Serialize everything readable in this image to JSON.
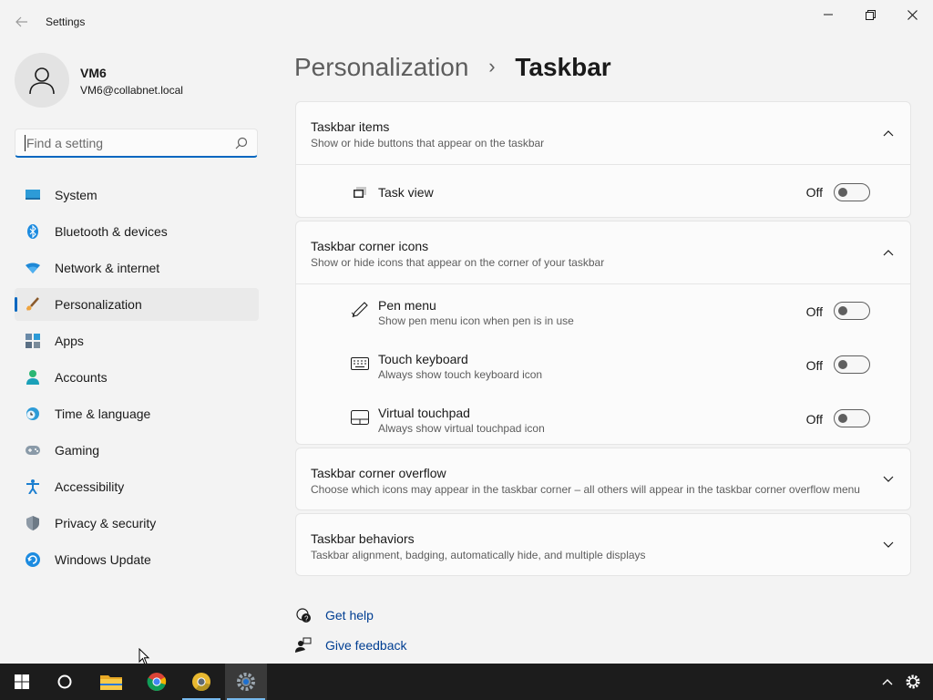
{
  "window": {
    "title": "Settings"
  },
  "profile": {
    "name": "VM6",
    "email": "VM6@collabnet.local"
  },
  "search": {
    "placeholder": "Find a setting"
  },
  "nav": [
    {
      "label": "System",
      "icon": "monitor-icon"
    },
    {
      "label": "Bluetooth & devices",
      "icon": "bluetooth-icon"
    },
    {
      "label": "Network & internet",
      "icon": "wifi-icon"
    },
    {
      "label": "Personalization",
      "icon": "brush-icon",
      "active": true
    },
    {
      "label": "Apps",
      "icon": "apps-icon"
    },
    {
      "label": "Accounts",
      "icon": "person-icon"
    },
    {
      "label": "Time & language",
      "icon": "clock-globe-icon"
    },
    {
      "label": "Gaming",
      "icon": "gamepad-icon"
    },
    {
      "label": "Accessibility",
      "icon": "accessibility-icon"
    },
    {
      "label": "Privacy & security",
      "icon": "shield-icon"
    },
    {
      "label": "Windows Update",
      "icon": "update-icon"
    }
  ],
  "breadcrumb": {
    "parent": "Personalization",
    "separator": "›",
    "current": "Taskbar"
  },
  "sections": {
    "taskbar_items": {
      "title": "Taskbar items",
      "desc": "Show or hide buttons that appear on the taskbar",
      "expanded": true,
      "rows": [
        {
          "title": "Task view",
          "state": "Off",
          "on": false
        }
      ]
    },
    "corner_icons": {
      "title": "Taskbar corner icons",
      "desc": "Show or hide icons that appear on the corner of your taskbar",
      "expanded": true,
      "rows": [
        {
          "title": "Pen menu",
          "desc": "Show pen menu icon when pen is in use",
          "state": "Off",
          "on": false
        },
        {
          "title": "Touch keyboard",
          "desc": "Always show touch keyboard icon",
          "state": "Off",
          "on": false
        },
        {
          "title": "Virtual touchpad",
          "desc": "Always show virtual touchpad icon",
          "state": "Off",
          "on": false
        }
      ]
    },
    "corner_overflow": {
      "title": "Taskbar corner overflow",
      "desc": "Choose which icons may appear in the taskbar corner – all others will appear in the taskbar corner overflow menu",
      "expanded": false
    },
    "behaviors": {
      "title": "Taskbar behaviors",
      "desc": "Taskbar alignment, badging, automatically hide, and multiple displays",
      "expanded": false
    }
  },
  "links": {
    "help": "Get help",
    "feedback": "Give feedback"
  },
  "taskbar": {
    "apps": [
      "start-icon",
      "cortana-icon",
      "file-explorer-icon",
      "chrome-icon",
      "chrome-canary-icon",
      "settings-icon"
    ],
    "tray": [
      "chevron-up-icon",
      "gear-icon"
    ]
  },
  "colors": {
    "accent": "#0067c0",
    "link": "#003e92",
    "taskbar": "#1c1c1c"
  }
}
